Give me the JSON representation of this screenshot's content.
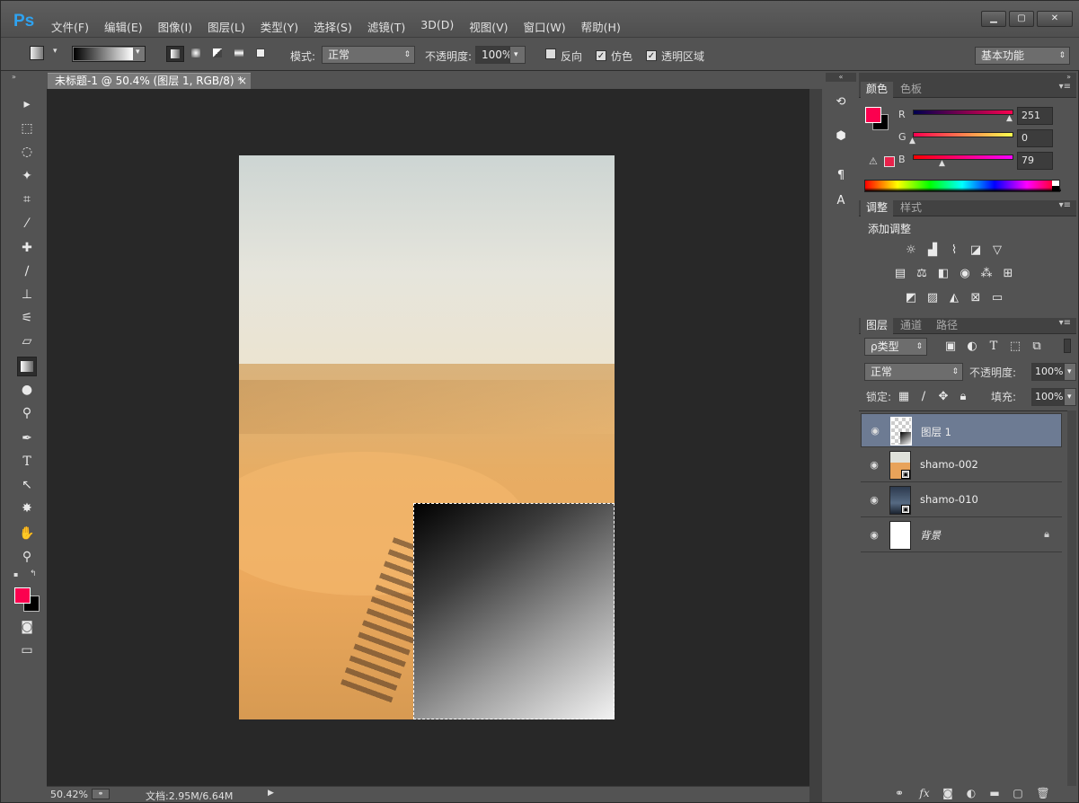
{
  "app": {
    "logo": "Ps"
  },
  "menu": [
    "文件(F)",
    "编辑(E)",
    "图像(I)",
    "图层(L)",
    "类型(Y)",
    "选择(S)",
    "滤镜(T)",
    "3D(D)",
    "视图(V)",
    "窗口(W)",
    "帮助(H)"
  ],
  "window_buttons": {
    "minimize": "▁",
    "maximize": "▢",
    "close": "✕"
  },
  "options": {
    "mode_label": "模式:",
    "mode_value": "正常",
    "opacity_label": "不透明度:",
    "opacity_value": "100%",
    "reverse_label": "反向",
    "dither_label": "仿色",
    "transparency_label": "透明区域",
    "workspace": "基本功能"
  },
  "document": {
    "tab_title": "未标题-1 @ 50.4% (图层 1, RGB/8) *",
    "close": "×"
  },
  "status": {
    "zoom": "50.42%",
    "doc_info": "文档:2.95M/6.64M"
  },
  "color_panel": {
    "tabs": [
      "颜色",
      "色板"
    ],
    "r_label": "R",
    "r_value": "251",
    "g_label": "G",
    "g_value": "0",
    "b_label": "B",
    "b_value": "79",
    "foreground": "#fb004f",
    "background": "#000000"
  },
  "adjust_panel": {
    "tabs": [
      "调整",
      "样式"
    ],
    "heading": "添加调整"
  },
  "layers_panel": {
    "tabs": [
      "图层",
      "通道",
      "路径"
    ],
    "filter_label": "ρ类型",
    "blend_mode": "正常",
    "opacity_label": "不透明度:",
    "opacity_value": "100%",
    "lock_label": "锁定:",
    "fill_label": "填充:",
    "fill_value": "100%",
    "layers": [
      {
        "name": "图层 1"
      },
      {
        "name": "shamo-002"
      },
      {
        "name": "shamo-010"
      },
      {
        "name": "背景"
      }
    ]
  },
  "colors": {
    "accent": "#2ea3f2",
    "selected_layer": "#6d7b93",
    "foreground": "#fb004f"
  }
}
